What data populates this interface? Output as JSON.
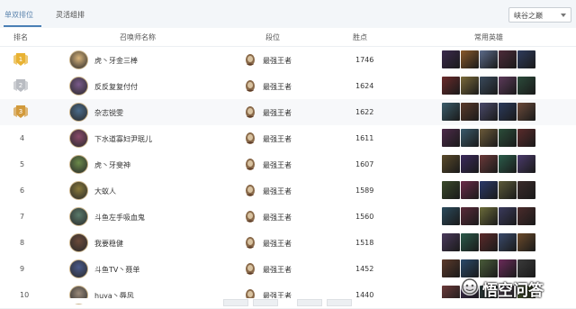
{
  "tabs": [
    {
      "label": "单双排位",
      "active": true
    },
    {
      "label": "灵活组排",
      "active": false
    }
  ],
  "region_select": {
    "value": "峡谷之巅"
  },
  "columns": [
    "排名",
    "召唤师名称",
    "段位",
    "胜点",
    "常用英雄"
  ],
  "rows": [
    {
      "rank": "1",
      "medal": "gold",
      "name": "虎丶牙金三棒",
      "tier": "最强王者",
      "points": "1746"
    },
    {
      "rank": "2",
      "medal": "silver",
      "name": "反反复复付付",
      "tier": "最强王者",
      "points": "1624"
    },
    {
      "rank": "3",
      "medal": "bronze",
      "name": "杂志锐雯",
      "tier": "最强王者",
      "points": "1622"
    },
    {
      "rank": "4",
      "medal": null,
      "name": "下水道寡妇尹珉儿",
      "tier": "最强王者",
      "points": "1611"
    },
    {
      "rank": "5",
      "medal": null,
      "name": "虎丶牙斐神",
      "tier": "最强王者",
      "points": "1607"
    },
    {
      "rank": "6",
      "medal": null,
      "name": "大蚁人",
      "tier": "最强王者",
      "points": "1589"
    },
    {
      "rank": "7",
      "medal": null,
      "name": "斗鱼左手吸血鬼",
      "tier": "最强王者",
      "points": "1560"
    },
    {
      "rank": "8",
      "medal": null,
      "name": "我要稳健",
      "tier": "最强王者",
      "points": "1518"
    },
    {
      "rank": "9",
      "medal": null,
      "name": "斗鱼TV丶聂单",
      "tier": "最强王者",
      "points": "1452"
    },
    {
      "rank": "10",
      "medal": null,
      "name": "huya丶辱风",
      "tier": "最强王者",
      "points": "1440"
    }
  ],
  "watermark": {
    "text": "悟空问答",
    "icon": "wukong-logo-icon"
  },
  "colors": {
    "accent": "#5a83ad",
    "gold": "#e8b233",
    "silver": "#b9bcc2",
    "bronze": "#d29a3c"
  }
}
